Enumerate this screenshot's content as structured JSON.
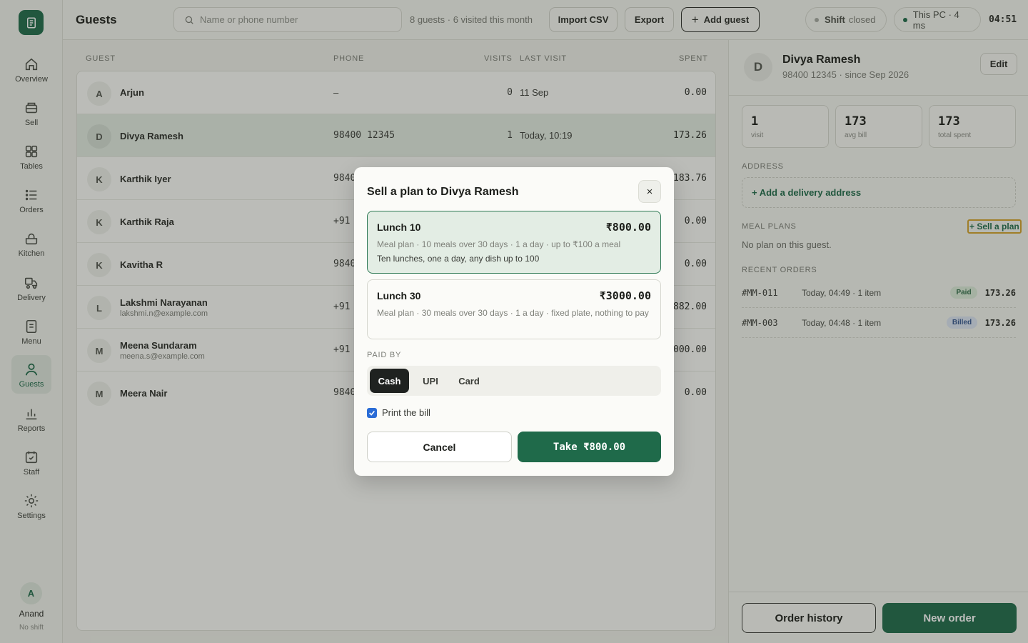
{
  "app": {
    "page_title": "Guests",
    "clock": "04:51"
  },
  "topbar": {
    "search_placeholder": "Name or phone number",
    "summary": "8 guests · 6 visited this month",
    "import_label": "Import CSV",
    "export_label": "Export",
    "add_label": "Add guest",
    "shift_key": "Shift",
    "shift_value": "closed",
    "device_status": "This PC · 4 ms"
  },
  "nav": {
    "items": [
      {
        "label": "Overview",
        "icon": "home-icon"
      },
      {
        "label": "Sell",
        "icon": "register-icon"
      },
      {
        "label": "Tables",
        "icon": "grid-icon"
      },
      {
        "label": "Orders",
        "icon": "list-icon"
      },
      {
        "label": "Kitchen",
        "icon": "pot-icon"
      },
      {
        "label": "Delivery",
        "icon": "scooter-icon"
      },
      {
        "label": "Menu",
        "icon": "menu-book-icon"
      },
      {
        "label": "Guests",
        "icon": "person-icon"
      },
      {
        "label": "Reports",
        "icon": "bar-chart-icon"
      },
      {
        "label": "Staff",
        "icon": "calendar-check-icon"
      },
      {
        "label": "Settings",
        "icon": "gear-icon"
      }
    ],
    "active": "Guests"
  },
  "user": {
    "initial": "A",
    "name": "Anand",
    "status": "No shift"
  },
  "table": {
    "headers": {
      "guest": "GUEST",
      "phone": "PHONE",
      "visits": "VISITS",
      "last": "LAST VISIT",
      "spent": "SPENT"
    },
    "rows": [
      {
        "initial": "A",
        "name": "Arjun",
        "email": "",
        "phone": "–",
        "visits": "0",
        "last": "11 Sep",
        "spent": "0.00"
      },
      {
        "initial": "D",
        "name": "Divya Ramesh",
        "email": "",
        "phone": "98400 12345",
        "visits": "1",
        "last": "Today, 10:19",
        "spent": "173.26"
      },
      {
        "initial": "K",
        "name": "Karthik Iyer",
        "email": "",
        "phone": "9840",
        "visits": "",
        "last": "",
        "spent": "183.76"
      },
      {
        "initial": "K",
        "name": "Karthik Raja",
        "email": "",
        "phone": "+91",
        "visits": "",
        "last": "",
        "spent": "0.00"
      },
      {
        "initial": "K",
        "name": "Kavitha R",
        "email": "",
        "phone": "9840",
        "visits": "",
        "last": "",
        "spent": "0.00"
      },
      {
        "initial": "L",
        "name": "Lakshmi Narayanan",
        "email": "lakshmi.n@example.com",
        "phone": "+91",
        "visits": "",
        "last": "",
        "spent": "882.00"
      },
      {
        "initial": "M",
        "name": "Meena Sundaram",
        "email": "meena.s@example.com",
        "phone": "+91",
        "visits": "",
        "last": "",
        "spent": "000.00"
      },
      {
        "initial": "M",
        "name": "Meera Nair",
        "email": "",
        "phone": "9840",
        "visits": "",
        "last": "",
        "spent": "0.00"
      }
    ]
  },
  "panel": {
    "initial": "D",
    "name": "Divya Ramesh",
    "subtitle": "98400 12345 · since Sep 2026",
    "edit_label": "Edit",
    "stats": [
      {
        "value": "1",
        "label": "visit"
      },
      {
        "value": "173",
        "label": "avg bill"
      },
      {
        "value": "173",
        "label": "total spent"
      }
    ],
    "address_title": "ADDRESS",
    "address_action": "+ Add a delivery address",
    "plans_title": "MEAL PLANS",
    "sell_plan": "+ Sell a plan",
    "no_plan": "No plan on this guest.",
    "orders_title": "RECENT ORDERS",
    "orders": [
      {
        "id": "#MM-011",
        "time": "Today, 04:49 · 1 item",
        "status": "Paid",
        "amount": "173.26",
        "bg": "#dcebd9",
        "fg": "#2e6a45"
      },
      {
        "id": "#MM-003",
        "time": "Today, 04:48 · 1 item",
        "status": "Billed",
        "amount": "173.26",
        "bg": "#dbe4f2",
        "fg": "#35568f"
      }
    ],
    "history_label": "Order history",
    "new_order_label": "New order"
  },
  "modal": {
    "title": "Sell a plan to Divya Ramesh",
    "close": "×",
    "plans": [
      {
        "name": "Lunch 10",
        "price": "₹800.00",
        "desc": "Meal plan · 10 meals over 30 days · 1 a day · up to ₹100 a meal",
        "note": "Ten lunches, one a day, any dish up to 100",
        "selected": true
      },
      {
        "name": "Lunch 30",
        "price": "₹3000.00",
        "desc": "Meal plan · 30 meals over 30 days · 1 a day · fixed plate, nothing to pay",
        "note": "",
        "selected": false
      }
    ],
    "paid_by_label": "PAID BY",
    "payment_options": [
      "Cash",
      "UPI",
      "Card"
    ],
    "selected_payment": "Cash",
    "print_label": "Print the bill",
    "print_checked": true,
    "cancel_label": "Cancel",
    "take_label": "Take ₹800.00"
  },
  "colors": {
    "accent": "#1f6a4a",
    "highlight_row": "#e2ebe1",
    "focus_ring": "#d4a22a",
    "checkbox": "#2a6cd6"
  }
}
